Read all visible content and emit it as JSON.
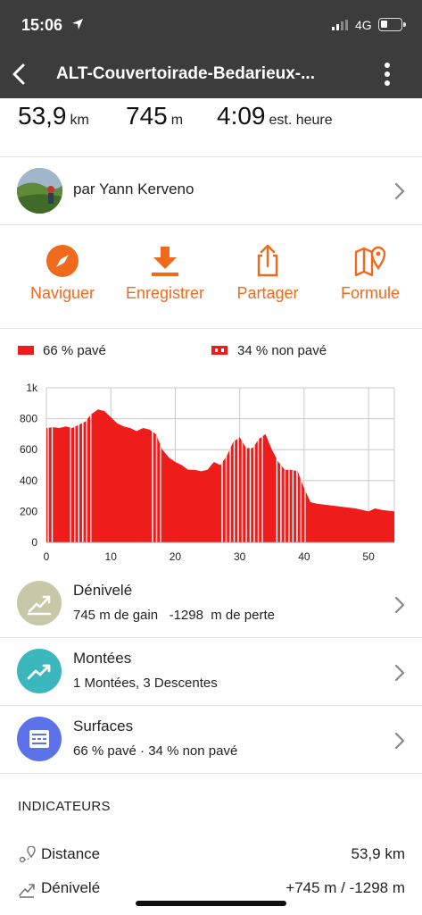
{
  "status_bar": {
    "time": "15:06",
    "network": "4G"
  },
  "header": {
    "title": "ALT-Couvertoirade-Bedarieux-..."
  },
  "stats": [
    {
      "value": "53,9",
      "unit": "km"
    },
    {
      "value": "745",
      "unit": "m"
    },
    {
      "value": "4:09",
      "unit": "est. heure"
    }
  ],
  "author": {
    "label": "par Yann Kerveno"
  },
  "actions": [
    {
      "label": "Naviguer",
      "icon": "compass-icon"
    },
    {
      "label": "Enregistrer",
      "icon": "download-icon"
    },
    {
      "label": "Partager",
      "icon": "share-icon"
    },
    {
      "label": "Formule",
      "icon": "map-pin-icon"
    }
  ],
  "legend": {
    "paved": "66 % pavé",
    "unpaved": "34 % non pavé"
  },
  "chart_data": {
    "type": "area",
    "x": [
      0,
      1,
      2,
      3,
      4,
      5,
      6,
      7,
      8,
      9,
      10,
      11,
      12,
      13,
      14,
      15,
      16,
      17,
      18,
      19,
      20,
      21,
      22,
      23,
      24,
      25,
      26,
      27,
      28,
      29,
      30,
      31,
      32,
      33,
      34,
      35,
      36,
      37,
      38,
      39,
      40,
      41,
      42,
      43,
      44,
      45,
      46,
      47,
      48,
      49,
      50,
      51,
      52,
      53,
      54
    ],
    "y": [
      740,
      745,
      740,
      750,
      740,
      760,
      780,
      830,
      860,
      850,
      810,
      770,
      750,
      740,
      720,
      740,
      730,
      700,
      600,
      550,
      520,
      500,
      470,
      470,
      460,
      470,
      520,
      500,
      560,
      650,
      680,
      610,
      610,
      670,
      700,
      600,
      520,
      470,
      470,
      460,
      350,
      260,
      250,
      245,
      240,
      235,
      230,
      225,
      220,
      210,
      200,
      220,
      210,
      205,
      200
    ],
    "x_ticks": [
      0,
      10,
      20,
      30,
      40,
      50
    ],
    "y_ticks": [
      "0",
      "200",
      "400",
      "600",
      "800",
      "1k"
    ],
    "y_tick_values": [
      0,
      200,
      400,
      600,
      800,
      1000
    ],
    "xlim": [
      0,
      54
    ],
    "ylim": [
      0,
      1000
    ],
    "grid": true,
    "unpaved_segments": [
      [
        0,
        1
      ],
      [
        3.5,
        7.5
      ],
      [
        16.2,
        18.3
      ],
      [
        27,
        34
      ],
      [
        35.5,
        40.5
      ]
    ],
    "colors": {
      "fill": "#ef1c1c",
      "stripe": "#ffffff",
      "grid": "#c8c8c8"
    }
  },
  "rows": [
    {
      "title": "Dénivelé",
      "subtitle": "745 m de gain   -1298  m de perte",
      "icon": "elevation-icon",
      "color": "#c7c8a8"
    },
    {
      "title": "Montées",
      "subtitle": "1 Montées, 3 Descentes",
      "icon": "trend-up-icon",
      "color": "#3bb6bd"
    },
    {
      "title": "Surfaces",
      "subtitle": "66 % pavé · 34 % non pavé",
      "icon": "surface-icon",
      "color": "#5b72e8"
    }
  ],
  "indicators": {
    "heading": "INDICATEURS",
    "items": [
      {
        "label": "Distance",
        "value": "53,9 km",
        "icon": "distance-icon"
      },
      {
        "label": "Dénivelé",
        "value": "+745 m / -1298 m",
        "icon": "elevation-small-icon"
      }
    ]
  },
  "accent_color": "#f06a1e"
}
